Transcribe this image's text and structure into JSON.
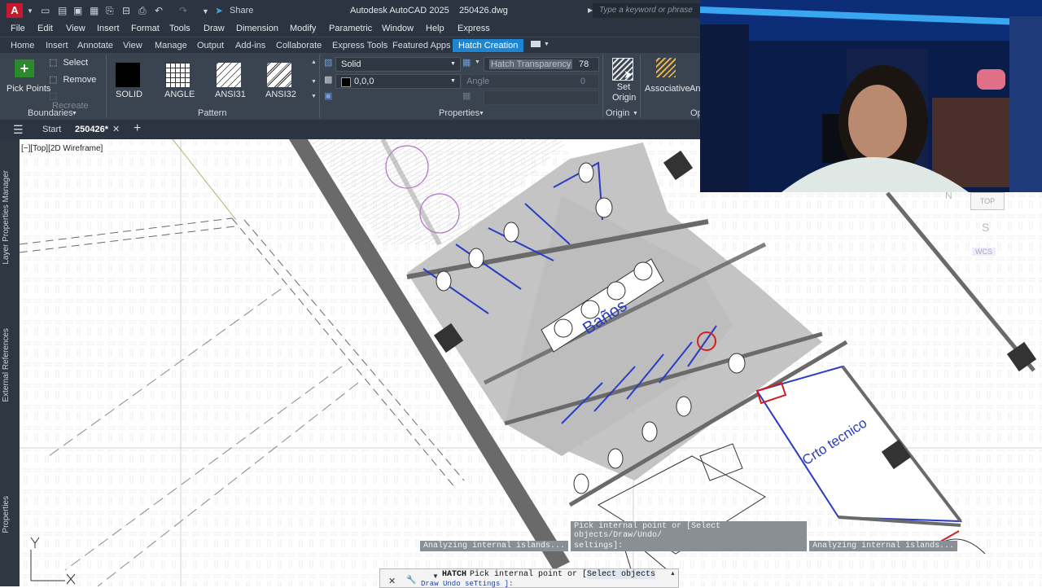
{
  "app": {
    "name": "Autodesk AutoCAD 2025",
    "file": "250426.dwg",
    "logo": "A"
  },
  "quick_access": {
    "share": "Share"
  },
  "search": {
    "placeholder": "Type a keyword or phrase"
  },
  "menu": [
    "File",
    "Edit",
    "View",
    "Insert",
    "Format",
    "Tools",
    "Draw",
    "Dimension",
    "Modify",
    "Parametric",
    "Window",
    "Help",
    "Express"
  ],
  "ribbon_tabs": [
    "Home",
    "Insert",
    "Annotate",
    "View",
    "Manage",
    "Output",
    "Add-ins",
    "Collaborate",
    "Express Tools",
    "Featured Apps",
    "Hatch Creation"
  ],
  "ribbon": {
    "boundaries": {
      "title": "Boundaries",
      "pick_points": "Pick Points",
      "select": "Select",
      "remove": "Remove",
      "recreate": "Recreate"
    },
    "pattern": {
      "title": "Pattern",
      "swatches": [
        "SOLID",
        "ANGLE",
        "ANSI31",
        "ANSI32"
      ]
    },
    "properties": {
      "title": "Properties",
      "type": "Solid",
      "color": "0,0,0",
      "transparency_label": "Hatch Transparency",
      "transparency_value": "78",
      "angle_label": "Angle",
      "angle_value": "0"
    },
    "origin": {
      "title": "Origin",
      "set_origin": "Set Origin"
    },
    "options": {
      "associative": "Associative",
      "annotative_cut": "An",
      "title_cut": "Op"
    }
  },
  "file_tabs": {
    "start": "Start",
    "current": "250426*"
  },
  "viewport": {
    "label": "[−][Top][2D Wireframe]"
  },
  "left_palettes": [
    "Layer Properties Manager",
    "External References",
    "Properties"
  ],
  "drawing": {
    "room1": "Baños",
    "room2": "Crto tecnico"
  },
  "viewcube": {
    "top": "TOP",
    "n": "N",
    "s": "S",
    "wcs": "WCS"
  },
  "command": {
    "history": [
      "Analyzing internal islands...",
      "Pick internal point or [Select objects/Draw/Undo/",
      "seltings]:",
      "Analyzing internal islands..."
    ],
    "active_cmd": "HATCH",
    "prompt": "Pick internal point or [",
    "option": "Select objects",
    "bottom_options": "Draw Undo seTtings ]:"
  },
  "colors": {
    "accent": "#1e86d0",
    "wall": "#5a5a5a",
    "hatch": "#c4c4c4",
    "blue_lines": "#2a3cc4"
  }
}
